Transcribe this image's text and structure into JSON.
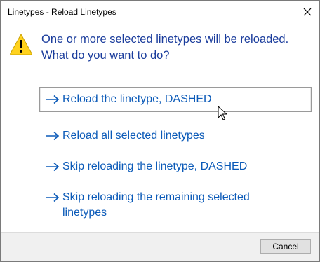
{
  "window": {
    "title": "Linetypes - Reload Linetypes",
    "close_icon": "close-icon"
  },
  "main": {
    "icon": "warning-icon",
    "instruction_lines": [
      "One or more selected linetypes will be reloaded.",
      "What do you want to do?"
    ],
    "commands": [
      {
        "label": "Reload the linetype, DASHED",
        "focused": true
      },
      {
        "label": "Reload all selected linetypes",
        "focused": false
      },
      {
        "label": "Skip reloading the linetype, DASHED",
        "focused": false
      },
      {
        "label": "Skip reloading the remaining selected linetypes",
        "focused": false
      }
    ]
  },
  "footer": {
    "cancel_label": "Cancel"
  },
  "colors": {
    "instruction": "#1a3c9c",
    "command_link": "#0b5ab8",
    "warning_fill": "#ffd21e",
    "footer_bg": "#f0f0f0"
  }
}
